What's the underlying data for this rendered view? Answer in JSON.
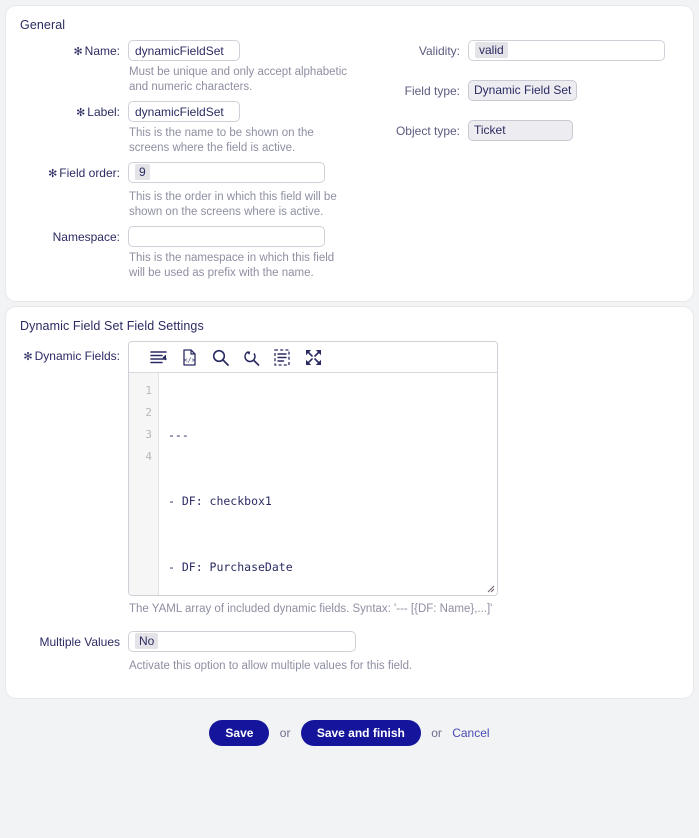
{
  "general": {
    "title": "General",
    "name": {
      "label": "Name:",
      "required": true,
      "value": "dynamicFieldSet",
      "hint": "Must be unique and only accept alphabetic and numeric characters."
    },
    "label": {
      "label": "Label:",
      "required": true,
      "value": "dynamicFieldSet",
      "hint": "This is the name to be shown on the screens where the field is active."
    },
    "field_order": {
      "label": "Field order:",
      "required": true,
      "value": "9",
      "hint": "This is the order in which this field will be shown on the screens where is active."
    },
    "namespace": {
      "label": "Namespace:",
      "required": false,
      "value": "",
      "hint": "This is the namespace in which this field will be used as prefix with the name."
    },
    "validity": {
      "label": "Validity:",
      "value": "valid"
    },
    "field_type": {
      "label": "Field type:",
      "value": "Dynamic Field Set"
    },
    "object_type": {
      "label": "Object type:",
      "value": "Ticket"
    }
  },
  "set_settings": {
    "title": "Dynamic Field Set Field Settings",
    "dynamic_fields": {
      "label": "Dynamic Fields:",
      "required": true,
      "toolbar": [
        {
          "name": "format-indent-icon",
          "title": "Format"
        },
        {
          "name": "code-file-icon",
          "title": "Source"
        },
        {
          "name": "search-icon",
          "title": "Search"
        },
        {
          "name": "search-replace-icon",
          "title": "Replace"
        },
        {
          "name": "select-all-icon",
          "title": "Select all"
        },
        {
          "name": "fullscreen-icon",
          "title": "Fullscreen"
        }
      ],
      "line_numbers": [
        "1",
        "2",
        "3",
        "4"
      ],
      "code_lines": [
        "---",
        "- DF: checkbox1",
        "- DF: PurchaseDate",
        ""
      ],
      "hint": "The YAML array of included dynamic fields. Syntax: '--- [{DF: Name},...]'"
    },
    "multiple_values": {
      "label": "Multiple Values",
      "value": "No",
      "hint": "Activate this option to allow multiple values for this field."
    }
  },
  "footer": {
    "save_label": "Save",
    "or_1": "or",
    "save_finish_label": "Save and finish",
    "or_2": "or",
    "cancel_label": "Cancel"
  },
  "colors": {
    "accent": "#15159c",
    "text": "#2b2b63",
    "hint": "#8e8fa2",
    "page_bg": "#f2f3f5"
  }
}
